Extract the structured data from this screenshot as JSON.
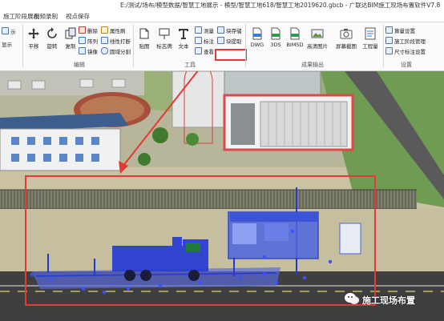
{
  "window": {
    "title": "E:/测试/场布/模型数据/智慧工地展示 - 模型/智慧工地618/智慧工地2019620.gbcb - 广联达BIM施工现场布置软件V7.8"
  },
  "tabs": [
    "施工阶段展示",
    "视频录制",
    "视点保存"
  ],
  "ribbon": {
    "left_partial": "示",
    "left_partial2": "显示",
    "edit": {
      "move": "平移",
      "rotate": "旋转",
      "copy": "复制",
      "delete": "删除",
      "array": "阵列",
      "mirror": "镜像",
      "properties": "属性刷",
      "line_break": "线性打断",
      "circle_split": "圆域分割",
      "group": "编辑"
    },
    "tools": {
      "paste": "贴图",
      "sign": "标志牌",
      "text": "文本",
      "measure": "测量",
      "annotate": "标注",
      "view": "查看",
      "block_store": "块存储",
      "block_extract": "块提取",
      "group": "工具"
    },
    "output": {
      "dwg": "DWG",
      "3ds": "3DS",
      "bim5d": "BIM5D",
      "drone_image": "高清图片",
      "screen_capture": "屏幕截图",
      "quantity": "工程量",
      "group": "成果输出"
    },
    "settings": {
      "calc_settings": "算量设置",
      "phase_manage": "施工阶段管理",
      "dimension_settings": "尺寸标注设置",
      "group": "设置"
    }
  },
  "watermark": {
    "text": "施工现场布置"
  },
  "colors": {
    "accent": "#e53935",
    "selection": "#3a52ff"
  }
}
